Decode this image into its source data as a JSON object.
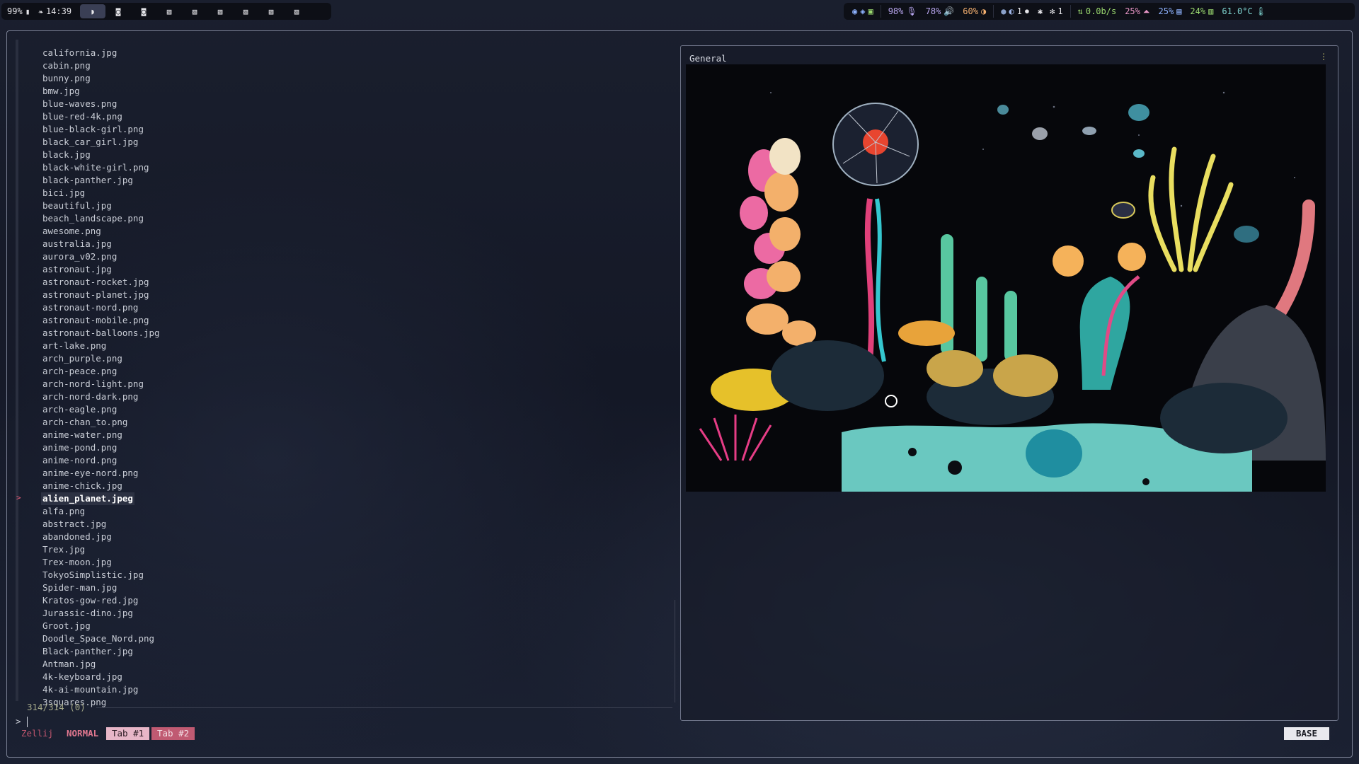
{
  "topbar": {
    "battery": "99%",
    "time": "14:39",
    "workspaces": [
      "ws1",
      "ws2",
      "ws3",
      "ws4",
      "ws5",
      "ws6",
      "ws7",
      "ws8",
      "ws9"
    ],
    "active_workspace_index": 0,
    "mic": "98%",
    "volume": "78%",
    "brightness": "60%",
    "notifications": "1",
    "bluetooth": "1",
    "network": "0.0b/s",
    "cpu": "25%",
    "memory": "25%",
    "disk": "24%",
    "temperature": "61.0°C"
  },
  "files": [
    "california.jpg",
    "cabin.png",
    "bunny.png",
    "bmw.jpg",
    "blue-waves.png",
    "blue-red-4k.png",
    "blue-black-girl.png",
    "black_car_girl.jpg",
    "black.jpg",
    "black-white-girl.png",
    "black-panther.jpg",
    "bici.jpg",
    "beautiful.jpg",
    "beach_landscape.png",
    "awesome.png",
    "australia.jpg",
    "aurora_v02.png",
    "astronaut.jpg",
    "astronaut-rocket.jpg",
    "astronaut-planet.jpg",
    "astronaut-nord.png",
    "astronaut-mobile.png",
    "astronaut-balloons.jpg",
    "art-lake.png",
    "arch_purple.png",
    "arch-peace.png",
    "arch-nord-light.png",
    "arch-nord-dark.png",
    "arch-eagle.png",
    "arch-chan_to.png",
    "anime-water.png",
    "anime-pond.png",
    "anime-nord.png",
    "anime-eye-nord.png",
    "anime-chick.jpg",
    "alien_planet.jpeg",
    "alfa.png",
    "abstract.jpg",
    "abandoned.jpg",
    "Trex.jpg",
    "Trex-moon.jpg",
    "TokyoSimplistic.jpg",
    "Spider-man.jpg",
    "Kratos-gow-red.jpg",
    "Jurassic-dino.jpg",
    "Groot.jpg",
    "Doodle_Space_Nord.png",
    "Black-panther.jpg",
    "Antman.jpg",
    "4k-keyboard.jpg",
    "4k-ai-mountain.jpg",
    "3squares.png"
  ],
  "selected_index": 35,
  "selected_marker": ">",
  "count": "314/314 (0)",
  "prompt": ">",
  "preview": {
    "title": "General",
    "menu_icon": "kebab-menu-icon"
  },
  "statusbar": {
    "session": "Zellij",
    "mode": "NORMAL",
    "tabs": [
      "Tab #1",
      "Tab #2"
    ],
    "input_mode": "BASE"
  },
  "colors": {
    "accent_pink": "#c05a72",
    "accent_light_pink": "#e7b6c8",
    "selected_bg": "#2c3142",
    "count_text": "#a4a888"
  }
}
